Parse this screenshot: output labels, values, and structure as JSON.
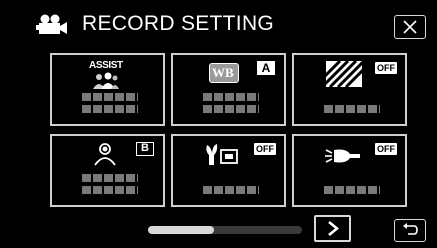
{
  "header": {
    "title": "RECORD SETTING",
    "icon": "movie-camera-icon",
    "close_icon": "close-icon"
  },
  "tiles": [
    {
      "id": "assist",
      "icon": "assist-icon",
      "badge_text": "ASSIST"
    },
    {
      "id": "white-balance",
      "icon": "wb-icon",
      "badge_text": "WB",
      "mode": "A"
    },
    {
      "id": "zebra",
      "icon": "zebra-pattern-icon",
      "state": "OFF"
    },
    {
      "id": "backlight",
      "icon": "backlight-person-icon",
      "mode": "B"
    },
    {
      "id": "tele-macro",
      "icon": "tele-macro-icon",
      "state": "OFF"
    },
    {
      "id": "light",
      "icon": "video-light-icon",
      "state": "OFF"
    }
  ],
  "footer": {
    "scroll_position": 0.0,
    "next_icon": "chevron-right-icon",
    "back_icon": "return-icon"
  }
}
